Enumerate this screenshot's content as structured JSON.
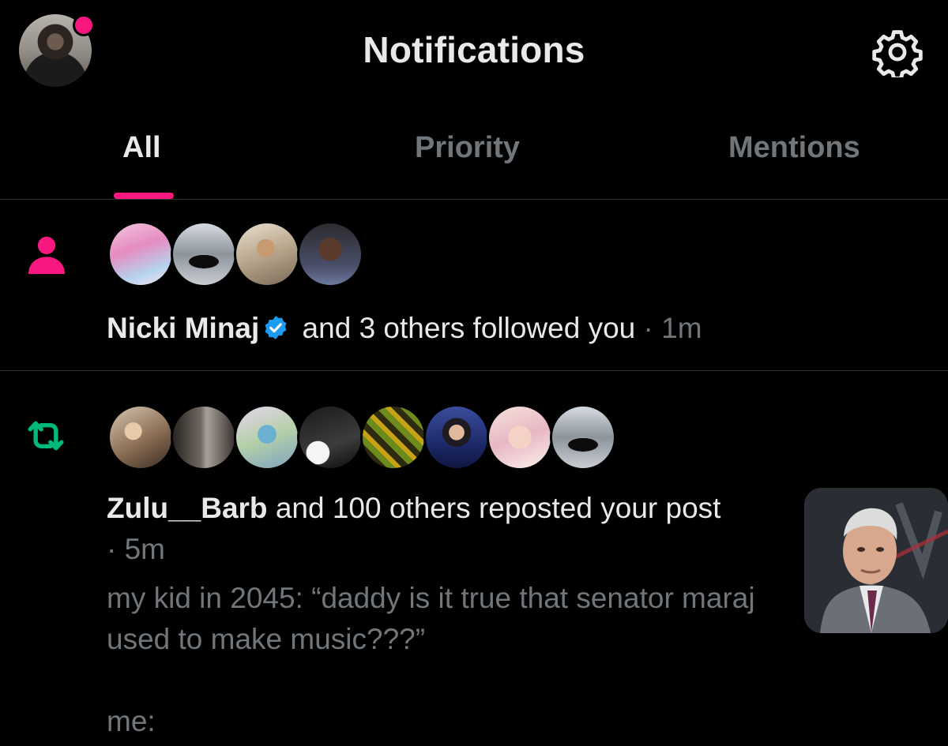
{
  "header": {
    "title": "Notifications",
    "avatar_icon": "profile-avatar",
    "settings_icon": "gear-icon",
    "unread_dot_color": "#f91880"
  },
  "tabs": [
    {
      "label": "All",
      "active": true
    },
    {
      "label": "Priority",
      "active": false
    },
    {
      "label": "Mentions",
      "active": false
    }
  ],
  "colors": {
    "accent": "#f91880",
    "repost": "#00ba7c",
    "verified": "#1d9bf0",
    "muted_text": "#71767b",
    "text": "#e7e9ea"
  },
  "notifications": [
    {
      "type": "follow",
      "icon": "person-icon",
      "avatar_count": 4,
      "name": "Nicki Minaj",
      "verified": true,
      "action": " and 3 others followed you",
      "separator": " · ",
      "time": "1m"
    },
    {
      "type": "repost",
      "icon": "repost-icon",
      "avatar_count": 8,
      "name": "Zulu__Barb",
      "action": " and 100 others reposted your post",
      "separator": " · ",
      "time": "5m",
      "post_text": "my kid in 2045: “daddy is it true that senator maraj used to make music???”\n\nme:",
      "thumbnail": "post-media-thumbnail"
    }
  ]
}
